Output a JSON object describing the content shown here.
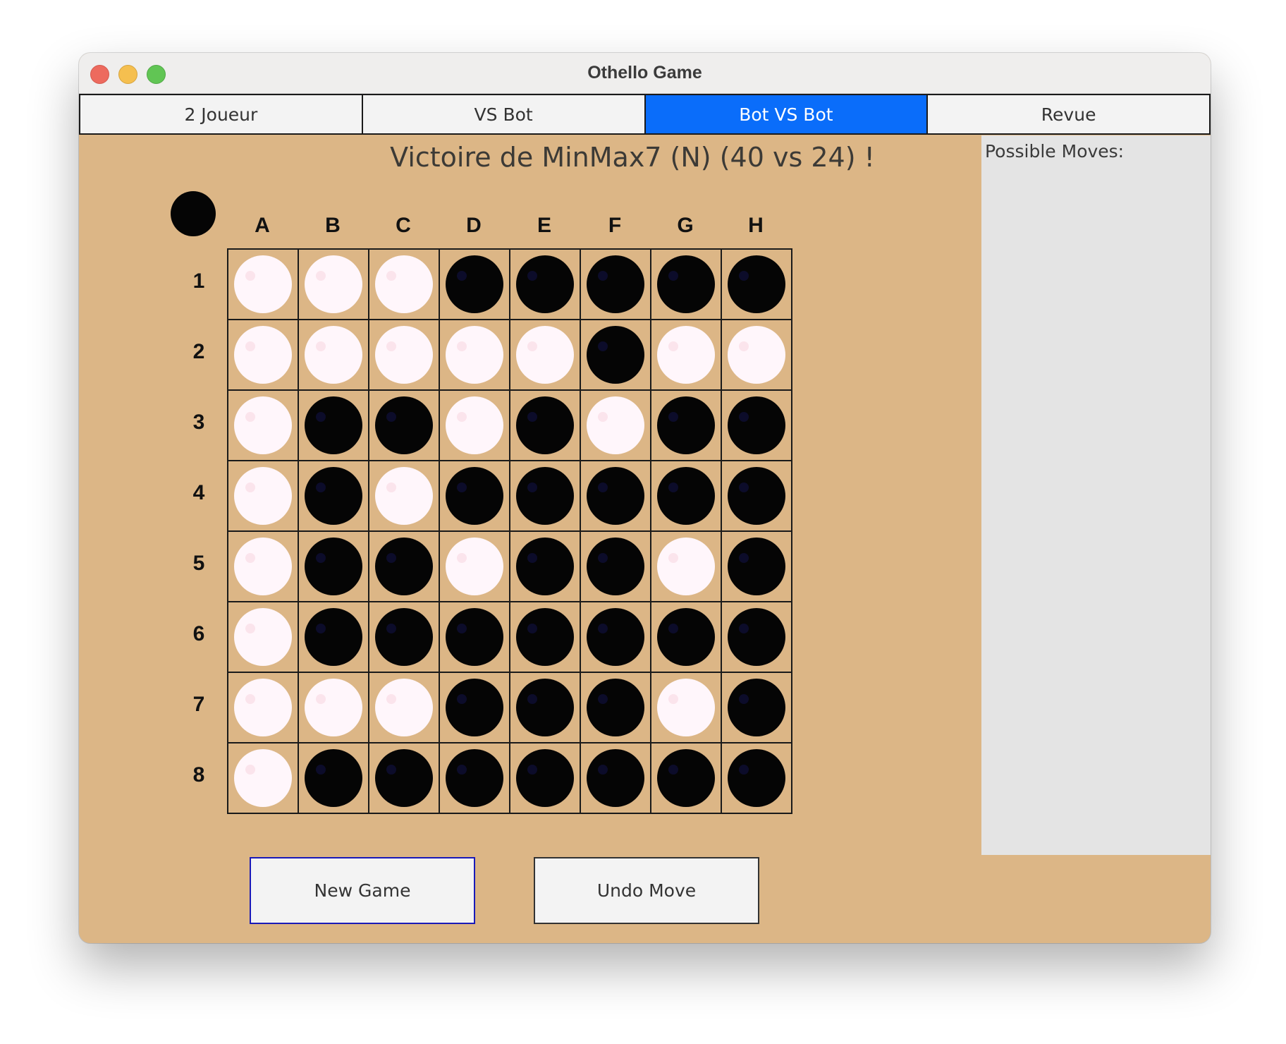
{
  "window": {
    "title": "Othello Game"
  },
  "tabs": [
    {
      "label": "2 Joueur",
      "active": false
    },
    {
      "label": "VS Bot",
      "active": false
    },
    {
      "label": "Bot VS Bot",
      "active": true
    },
    {
      "label": "Revue",
      "active": false
    }
  ],
  "game": {
    "status": "Victoire de MinMax7 (N) (40 vs 24) !",
    "current_turn": "black",
    "columns": [
      "A",
      "B",
      "C",
      "D",
      "E",
      "F",
      "G",
      "H"
    ],
    "rows": [
      "1",
      "2",
      "3",
      "4",
      "5",
      "6",
      "7",
      "8"
    ],
    "board": [
      [
        "W",
        "W",
        "W",
        "B",
        "B",
        "B",
        "B",
        "B"
      ],
      [
        "W",
        "W",
        "W",
        "W",
        "W",
        "B",
        "W",
        "W"
      ],
      [
        "W",
        "B",
        "B",
        "W",
        "B",
        "W",
        "B",
        "B"
      ],
      [
        "W",
        "B",
        "W",
        "B",
        "B",
        "B",
        "B",
        "B"
      ],
      [
        "W",
        "B",
        "B",
        "W",
        "B",
        "B",
        "W",
        "B"
      ],
      [
        "W",
        "B",
        "B",
        "B",
        "B",
        "B",
        "B",
        "B"
      ],
      [
        "W",
        "W",
        "W",
        "B",
        "B",
        "B",
        "W",
        "B"
      ],
      [
        "W",
        "B",
        "B",
        "B",
        "B",
        "B",
        "B",
        "B"
      ]
    ]
  },
  "side_panel": {
    "label": "Possible Moves:"
  },
  "buttons": {
    "new_game": "New Game",
    "undo_move": "Undo Move"
  },
  "colors": {
    "board_bg": "#dcb686",
    "tab_active": "#0a6dfa",
    "black_piece": "#050505",
    "white_piece": "#fff6fb"
  }
}
